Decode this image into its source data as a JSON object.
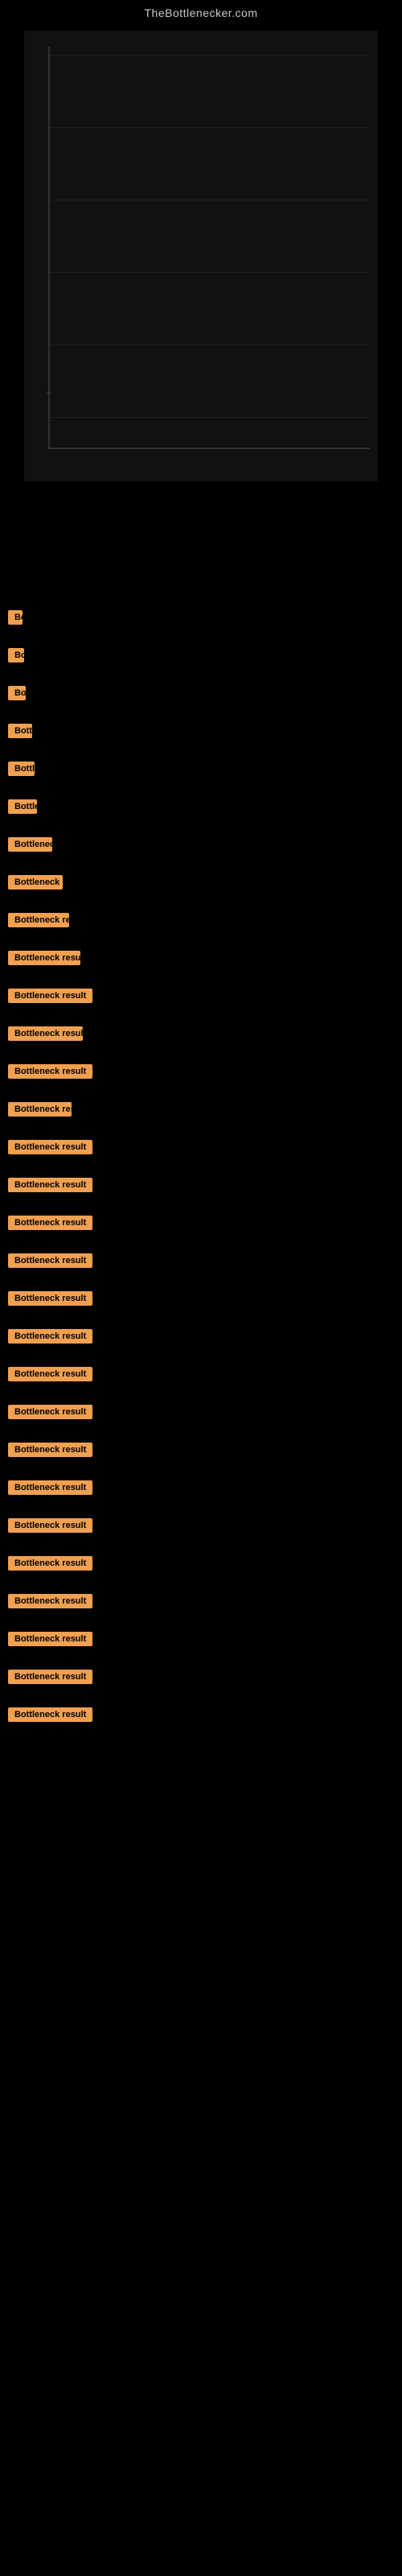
{
  "site": {
    "title": "TheBottlenecker.com"
  },
  "results": [
    {
      "id": 1,
      "label": "Bottleneck result",
      "badge_width": 15,
      "size_class": "badge-xs"
    },
    {
      "id": 2,
      "label": "Bottleneck result",
      "badge_width": 20,
      "size_class": "badge-xs"
    },
    {
      "id": 3,
      "label": "Bottleneck result",
      "badge_width": 22,
      "size_class": "badge-xs"
    },
    {
      "id": 4,
      "label": "Bottleneck result",
      "badge_width": 30,
      "size_class": "badge-sm"
    },
    {
      "id": 5,
      "label": "Bottleneck result",
      "badge_width": 32,
      "size_class": "badge-sm"
    },
    {
      "id": 6,
      "label": "Bottleneck result",
      "badge_width": 35,
      "size_class": "badge-sm"
    },
    {
      "id": 7,
      "label": "Bottleneck result",
      "badge_width": 50,
      "size_class": "badge-md"
    },
    {
      "id": 8,
      "label": "Bottleneck result",
      "badge_width": 65,
      "size_class": "badge-lg"
    },
    {
      "id": 9,
      "label": "Bottleneck result",
      "badge_width": 72,
      "size_class": "badge-lg"
    },
    {
      "id": 10,
      "label": "Bottleneck result",
      "badge_width": 85,
      "size_class": "badge-xl"
    },
    {
      "id": 11,
      "label": "Bottleneck result",
      "badge_width": 100,
      "size_class": "badge-xl"
    },
    {
      "id": 12,
      "label": "Bottleneck result",
      "badge_width": 88,
      "size_class": "badge-xl"
    },
    {
      "id": 13,
      "label": "Bottleneck result",
      "badge_width": 105,
      "size_class": "badge-xxl"
    },
    {
      "id": 14,
      "label": "Bottleneck result",
      "badge_width": 75,
      "size_class": "badge-xl"
    },
    {
      "id": 15,
      "label": "Bottleneck result",
      "badge_width": 110,
      "size_class": "badge-xxl"
    },
    {
      "id": 16,
      "label": "Bottleneck result",
      "badge_width": 115,
      "size_class": "badge-xxl"
    },
    {
      "id": 17,
      "label": "Bottleneck result",
      "badge_width": 120,
      "size_class": "badge-full"
    },
    {
      "id": 18,
      "label": "Bottleneck result",
      "badge_width": 125,
      "size_class": "badge-full"
    },
    {
      "id": 19,
      "label": "Bottleneck result",
      "badge_width": 130,
      "size_class": "badge-full"
    },
    {
      "id": 20,
      "label": "Bottleneck result",
      "badge_width": 135,
      "size_class": "badge-full"
    },
    {
      "id": 21,
      "label": "Bottleneck result",
      "badge_width": 138,
      "size_class": "badge-full"
    },
    {
      "id": 22,
      "label": "Bottleneck result",
      "badge_width": 140,
      "size_class": "badge-full"
    },
    {
      "id": 23,
      "label": "Bottleneck result",
      "badge_width": 142,
      "size_class": "badge-full"
    },
    {
      "id": 24,
      "label": "Bottleneck result",
      "badge_width": 145,
      "size_class": "badge-full"
    },
    {
      "id": 25,
      "label": "Bottleneck result",
      "badge_width": 148,
      "size_class": "badge-full"
    },
    {
      "id": 26,
      "label": "Bottleneck result",
      "badge_width": 150,
      "size_class": "badge-full"
    },
    {
      "id": 27,
      "label": "Bottleneck result",
      "badge_width": 152,
      "size_class": "badge-full"
    },
    {
      "id": 28,
      "label": "Bottleneck result",
      "badge_width": 155,
      "size_class": "badge-full"
    },
    {
      "id": 29,
      "label": "Bottleneck result",
      "badge_width": 157,
      "size_class": "badge-full"
    },
    {
      "id": 30,
      "label": "Bottleneck result",
      "badge_width": 160,
      "size_class": "badge-full"
    }
  ],
  "colors": {
    "background": "#000000",
    "badge_bg": "#f0a050",
    "badge_text": "#000000",
    "site_title": "#cccccc"
  }
}
